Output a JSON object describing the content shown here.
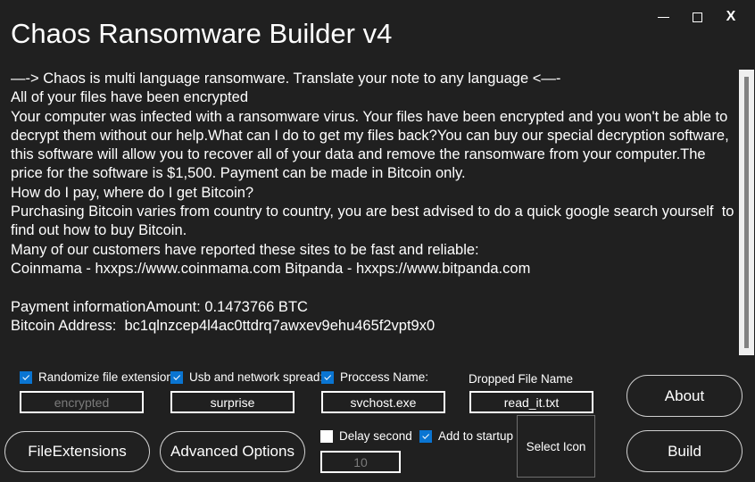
{
  "window": {
    "title": "Chaos Ransomware Builder v4",
    "minimize_label": "—",
    "maximize_label": "",
    "close_label": "X"
  },
  "note": {
    "text": "—-> Chaos is multi language ransomware. Translate your note to any language <—-\nAll of your files have been encrypted\nYour computer was infected with a ransomware virus. Your files have been encrypted and you won't be able to decrypt them without our help.What can I do to get my files back?You can buy our special decryption software, this software will allow you to recover all of your data and remove the ransomware from your computer.The price for the software is $1,500. Payment can be made in Bitcoin only.\nHow do I pay, where do I get Bitcoin?\nPurchasing Bitcoin varies from country to country, you are best advised to do a quick google search yourself  to find out how to buy Bitcoin.\nMany of our customers have reported these sites to be fast and reliable:\nCoinmama - hxxps://www.coinmama.com Bitpanda - hxxps://www.bitpanda.com\n\nPayment informationAmount: 0.1473766 BTC\nBitcoin Address:  bc1qlnzcep4l4ac0ttdrq7awxev9ehu465f2vpt9x0"
  },
  "controls": {
    "randomize_extension": {
      "label": "Randomize file extension:",
      "checked": true,
      "value": "encrypted",
      "is_placeholder": true
    },
    "usb_spread": {
      "label": "Usb and network spread:",
      "checked": true,
      "value": "surprise",
      "is_placeholder": false
    },
    "process_name": {
      "label": "Proccess Name:",
      "checked": true,
      "value": "svchost.exe",
      "is_placeholder": false
    },
    "dropped_file": {
      "label": "Dropped File Name",
      "value": "read_it.txt",
      "is_placeholder": false
    },
    "delay_second": {
      "label": "Delay second",
      "checked": false,
      "value": "10",
      "is_placeholder": true
    },
    "add_to_startup": {
      "label": "Add to startup",
      "checked": true
    },
    "select_icon_label": "Select Icon",
    "file_extensions_label": "FileExtensions",
    "advanced_options_label": "Advanced Options",
    "about_label": "About",
    "build_label": "Build"
  },
  "colors": {
    "background": "#202020",
    "accent": "#0a75d2",
    "text": "#ffffff",
    "placeholder": "#7b7b7b",
    "scrollbar_track": "#efefef",
    "scrollbar_thumb": "#828282"
  }
}
